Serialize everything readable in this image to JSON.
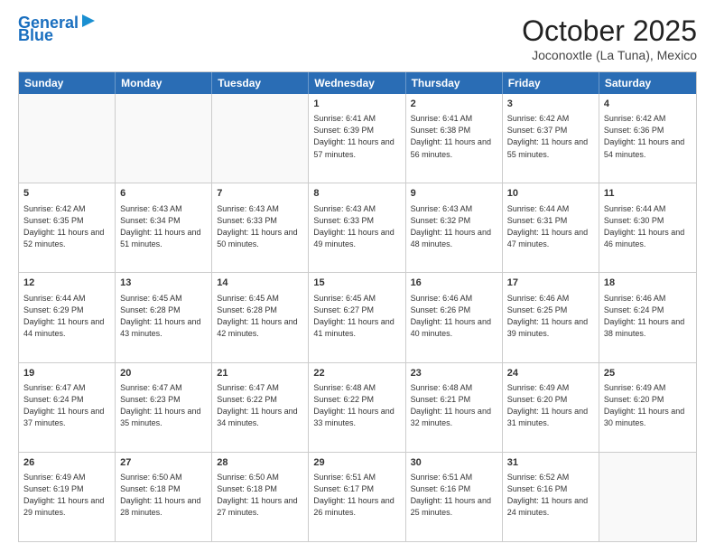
{
  "logo": {
    "line1": "General",
    "line2": "Blue"
  },
  "title": "October 2025",
  "subtitle": "Joconoxtle (La Tuna), Mexico",
  "header_days": [
    "Sunday",
    "Monday",
    "Tuesday",
    "Wednesday",
    "Thursday",
    "Friday",
    "Saturday"
  ],
  "rows": [
    [
      {
        "day": "",
        "info": ""
      },
      {
        "day": "",
        "info": ""
      },
      {
        "day": "",
        "info": ""
      },
      {
        "day": "1",
        "info": "Sunrise: 6:41 AM\nSunset: 6:39 PM\nDaylight: 11 hours and 57 minutes."
      },
      {
        "day": "2",
        "info": "Sunrise: 6:41 AM\nSunset: 6:38 PM\nDaylight: 11 hours and 56 minutes."
      },
      {
        "day": "3",
        "info": "Sunrise: 6:42 AM\nSunset: 6:37 PM\nDaylight: 11 hours and 55 minutes."
      },
      {
        "day": "4",
        "info": "Sunrise: 6:42 AM\nSunset: 6:36 PM\nDaylight: 11 hours and 54 minutes."
      }
    ],
    [
      {
        "day": "5",
        "info": "Sunrise: 6:42 AM\nSunset: 6:35 PM\nDaylight: 11 hours and 52 minutes."
      },
      {
        "day": "6",
        "info": "Sunrise: 6:43 AM\nSunset: 6:34 PM\nDaylight: 11 hours and 51 minutes."
      },
      {
        "day": "7",
        "info": "Sunrise: 6:43 AM\nSunset: 6:33 PM\nDaylight: 11 hours and 50 minutes."
      },
      {
        "day": "8",
        "info": "Sunrise: 6:43 AM\nSunset: 6:33 PM\nDaylight: 11 hours and 49 minutes."
      },
      {
        "day": "9",
        "info": "Sunrise: 6:43 AM\nSunset: 6:32 PM\nDaylight: 11 hours and 48 minutes."
      },
      {
        "day": "10",
        "info": "Sunrise: 6:44 AM\nSunset: 6:31 PM\nDaylight: 11 hours and 47 minutes."
      },
      {
        "day": "11",
        "info": "Sunrise: 6:44 AM\nSunset: 6:30 PM\nDaylight: 11 hours and 46 minutes."
      }
    ],
    [
      {
        "day": "12",
        "info": "Sunrise: 6:44 AM\nSunset: 6:29 PM\nDaylight: 11 hours and 44 minutes."
      },
      {
        "day": "13",
        "info": "Sunrise: 6:45 AM\nSunset: 6:28 PM\nDaylight: 11 hours and 43 minutes."
      },
      {
        "day": "14",
        "info": "Sunrise: 6:45 AM\nSunset: 6:28 PM\nDaylight: 11 hours and 42 minutes."
      },
      {
        "day": "15",
        "info": "Sunrise: 6:45 AM\nSunset: 6:27 PM\nDaylight: 11 hours and 41 minutes."
      },
      {
        "day": "16",
        "info": "Sunrise: 6:46 AM\nSunset: 6:26 PM\nDaylight: 11 hours and 40 minutes."
      },
      {
        "day": "17",
        "info": "Sunrise: 6:46 AM\nSunset: 6:25 PM\nDaylight: 11 hours and 39 minutes."
      },
      {
        "day": "18",
        "info": "Sunrise: 6:46 AM\nSunset: 6:24 PM\nDaylight: 11 hours and 38 minutes."
      }
    ],
    [
      {
        "day": "19",
        "info": "Sunrise: 6:47 AM\nSunset: 6:24 PM\nDaylight: 11 hours and 37 minutes."
      },
      {
        "day": "20",
        "info": "Sunrise: 6:47 AM\nSunset: 6:23 PM\nDaylight: 11 hours and 35 minutes."
      },
      {
        "day": "21",
        "info": "Sunrise: 6:47 AM\nSunset: 6:22 PM\nDaylight: 11 hours and 34 minutes."
      },
      {
        "day": "22",
        "info": "Sunrise: 6:48 AM\nSunset: 6:22 PM\nDaylight: 11 hours and 33 minutes."
      },
      {
        "day": "23",
        "info": "Sunrise: 6:48 AM\nSunset: 6:21 PM\nDaylight: 11 hours and 32 minutes."
      },
      {
        "day": "24",
        "info": "Sunrise: 6:49 AM\nSunset: 6:20 PM\nDaylight: 11 hours and 31 minutes."
      },
      {
        "day": "25",
        "info": "Sunrise: 6:49 AM\nSunset: 6:20 PM\nDaylight: 11 hours and 30 minutes."
      }
    ],
    [
      {
        "day": "26",
        "info": "Sunrise: 6:49 AM\nSunset: 6:19 PM\nDaylight: 11 hours and 29 minutes."
      },
      {
        "day": "27",
        "info": "Sunrise: 6:50 AM\nSunset: 6:18 PM\nDaylight: 11 hours and 28 minutes."
      },
      {
        "day": "28",
        "info": "Sunrise: 6:50 AM\nSunset: 6:18 PM\nDaylight: 11 hours and 27 minutes."
      },
      {
        "day": "29",
        "info": "Sunrise: 6:51 AM\nSunset: 6:17 PM\nDaylight: 11 hours and 26 minutes."
      },
      {
        "day": "30",
        "info": "Sunrise: 6:51 AM\nSunset: 6:16 PM\nDaylight: 11 hours and 25 minutes."
      },
      {
        "day": "31",
        "info": "Sunrise: 6:52 AM\nSunset: 6:16 PM\nDaylight: 11 hours and 24 minutes."
      },
      {
        "day": "",
        "info": ""
      }
    ]
  ]
}
